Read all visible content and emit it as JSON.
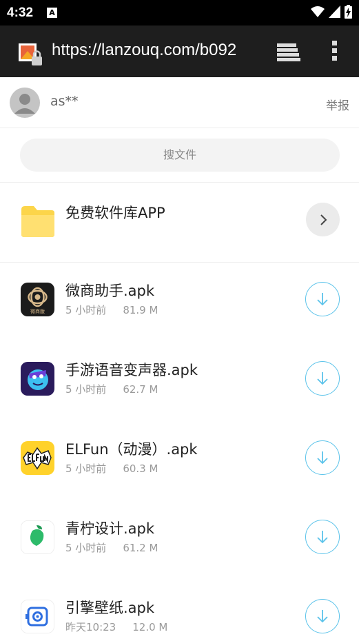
{
  "status_bar": {
    "time": "4:32",
    "notification_icon": "A"
  },
  "browser": {
    "url": "https://lanzouq.com/b092"
  },
  "user": {
    "name": "as**",
    "report_label": "举报"
  },
  "search": {
    "placeholder": "搜文件"
  },
  "folder": {
    "name": "免费软件库APP"
  },
  "files": [
    {
      "name": "微商助手.apk",
      "time": "5 小时前",
      "size": "81.9 M",
      "icon": "weishang-app-icon"
    },
    {
      "name": "手游语音变声器.apk",
      "time": "5 小时前",
      "size": "62.7 M",
      "icon": "voice-changer-app-icon"
    },
    {
      "name": "ELFun（动漫）.apk",
      "time": "5 小时前",
      "size": "60.3 M",
      "icon": "elfun-app-icon"
    },
    {
      "name": "青柠设计.apk",
      "time": "5 小时前",
      "size": "61.2 M",
      "icon": "qingning-app-icon"
    },
    {
      "name": "引擎壁纸.apk",
      "time": "昨天10:23",
      "size": "12.0 M",
      "icon": "engine-wallpaper-app-icon"
    }
  ],
  "colors": {
    "accent": "#5bc3ea",
    "folder": "#fcd54a",
    "toolbar": "#1e1e1e"
  },
  "icon_labels": {
    "weishang_badge": "微商版"
  }
}
